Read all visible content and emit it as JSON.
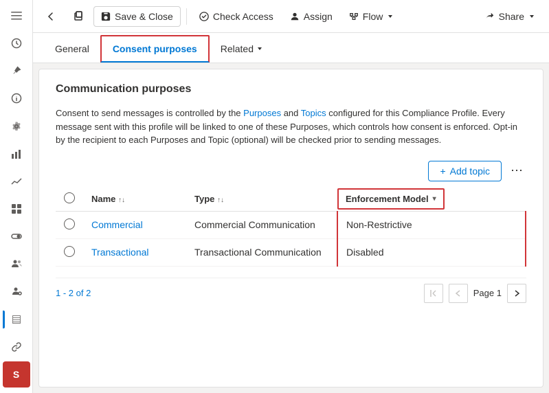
{
  "sidebar": {
    "icons": [
      {
        "name": "menu-icon",
        "symbol": "☰",
        "active": false
      },
      {
        "name": "clock-icon",
        "symbol": "🕐",
        "active": false
      },
      {
        "name": "pin-icon",
        "symbol": "📌",
        "active": false
      },
      {
        "name": "info-icon",
        "symbol": "ℹ",
        "active": false
      },
      {
        "name": "settings-icon",
        "symbol": "⚙",
        "active": false
      },
      {
        "name": "chart-icon",
        "symbol": "📊",
        "active": false
      },
      {
        "name": "analytics-icon",
        "symbol": "📈",
        "active": false
      },
      {
        "name": "grid-icon",
        "symbol": "⊞",
        "active": false
      },
      {
        "name": "toggle-icon",
        "symbol": "◉",
        "active": false
      },
      {
        "name": "users-icon",
        "symbol": "👥",
        "active": false
      },
      {
        "name": "user-settings-icon",
        "symbol": "👤",
        "active": false
      },
      {
        "name": "table-icon",
        "symbol": "⊟",
        "active": true
      },
      {
        "name": "link-icon",
        "symbol": "🔗",
        "active": false
      },
      {
        "name": "user-circle-icon",
        "symbol": "S",
        "active": false,
        "avatar": true
      }
    ]
  },
  "toolbar": {
    "back_icon": "←",
    "restore_icon": "⊡",
    "save_close_label": "Save & Close",
    "check_access_label": "Check Access",
    "assign_label": "Assign",
    "flow_label": "Flow",
    "flow_dropdown_icon": "▾",
    "share_label": "Share",
    "share_icon": "↗",
    "share_dropdown_icon": "▾"
  },
  "tabs": {
    "general_label": "General",
    "consent_label": "Consent purposes",
    "related_label": "Related",
    "related_dropdown_icon": "▾"
  },
  "section": {
    "title": "Communication purposes",
    "description_parts": [
      "Consent to send messages is controlled by the ",
      "Purposes",
      " and ",
      "Topics",
      " configured for this Compliance Profile. Every message sent with this profile will be linked to one of these Purposes, which controls how consent is enforced. Opt-in by the recipient to each Purposes and Topic (optional) will be checked prior to sending messages."
    ]
  },
  "add_topic_btn": "Add topic",
  "more_options": "⋯",
  "table": {
    "columns": [
      {
        "id": "select",
        "label": ""
      },
      {
        "id": "name",
        "label": "Name",
        "sortable": true
      },
      {
        "id": "type",
        "label": "Type",
        "sortable": true
      },
      {
        "id": "enforcement",
        "label": "Enforcement Model",
        "sortable": true,
        "highlighted": true
      }
    ],
    "rows": [
      {
        "name": "Commercial",
        "type": "Commercial Communication",
        "enforcement": "Non-Restrictive"
      },
      {
        "name": "Transactional",
        "type": "Transactional Communication",
        "enforcement": "Disabled"
      }
    ]
  },
  "pagination": {
    "info": "1 - 2 of 2",
    "first_icon": "⏮",
    "prev_icon": "←",
    "page_label": "Page",
    "page_number": "1",
    "next_icon": "→"
  }
}
